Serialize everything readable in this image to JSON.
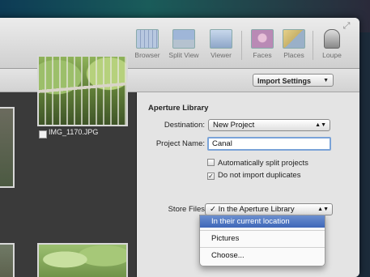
{
  "toolbar": {
    "items": [
      {
        "label": "Browser",
        "icon": "browser-grid-icon"
      },
      {
        "label": "Split View",
        "icon": "split-view-icon"
      },
      {
        "label": "Viewer",
        "icon": "viewer-icon"
      },
      {
        "label": "Faces",
        "icon": "faces-icon"
      },
      {
        "label": "Places",
        "icon": "places-map-icon"
      },
      {
        "label": "Loupe",
        "icon": "loupe-icon"
      }
    ]
  },
  "subbar": {
    "import_settings": "Import Settings"
  },
  "browser": {
    "thumb_label": "IMG_1170.JPG"
  },
  "panel": {
    "title": "Aperture Library",
    "destination": {
      "label": "Destination:",
      "value": "New Project"
    },
    "project_name": {
      "label": "Project Name:",
      "value": "Canal"
    },
    "auto_split": {
      "label": "Automatically split projects",
      "checked": false
    },
    "no_duplicates": {
      "label": "Do not import duplicates",
      "checked": true,
      "mark": "✓"
    },
    "store_files": {
      "label": "Store Files"
    }
  },
  "menu": {
    "items": [
      {
        "label": "✓ In the Aperture Library"
      },
      {
        "label": "In their current location",
        "highlighted": true
      },
      {
        "label": "Pictures"
      },
      {
        "label": "Choose..."
      }
    ]
  }
}
